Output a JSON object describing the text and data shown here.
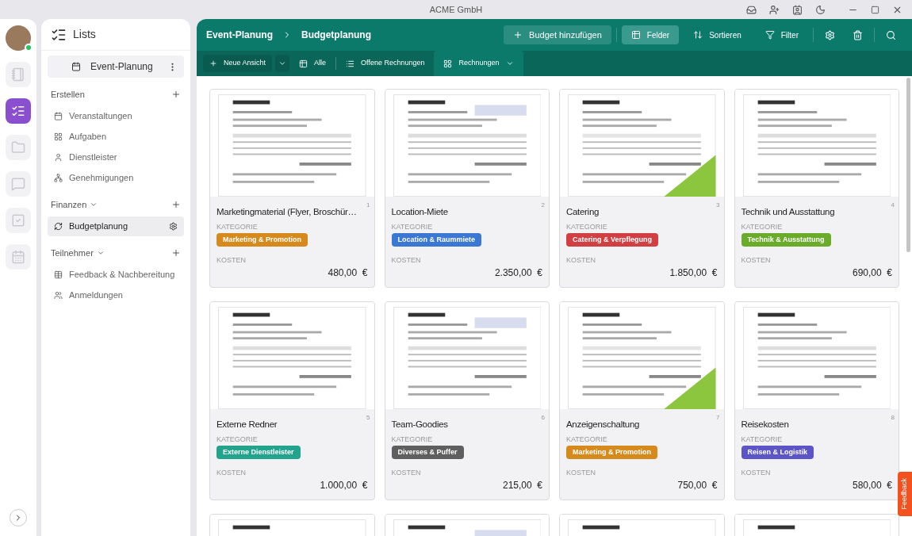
{
  "window": {
    "title": "ACME GmbH"
  },
  "rail": {
    "online": true,
    "items": [
      {
        "kind": "notebook",
        "selected": false
      },
      {
        "kind": "lists",
        "selected": true
      },
      {
        "kind": "folder",
        "selected": false
      },
      {
        "kind": "chat",
        "selected": false
      },
      {
        "kind": "tasks",
        "selected": false
      },
      {
        "kind": "calendar",
        "selected": false
      }
    ]
  },
  "sidebar": {
    "title": "Lists",
    "workspace": "Event-Planung",
    "sections": [
      {
        "title": "Erstellen",
        "collapsible": false,
        "items": [
          {
            "label": "Veranstaltungen",
            "kind": "calendar",
            "selected": false
          },
          {
            "label": "Aufgaben",
            "kind": "grid",
            "selected": false
          },
          {
            "label": "Dienstleister",
            "kind": "person",
            "selected": false
          },
          {
            "label": "Genehmigungen",
            "kind": "org",
            "selected": false
          }
        ]
      },
      {
        "title": "Finanzen",
        "collapsible": true,
        "items": [
          {
            "label": "Budgetplanung",
            "kind": "cycle",
            "selected": true
          }
        ]
      },
      {
        "title": "Teilnehmer",
        "collapsible": true,
        "items": [
          {
            "label": "Feedback & Nachbereitung",
            "kind": "table",
            "selected": false
          },
          {
            "label": "Anmeldungen",
            "kind": "people",
            "selected": false
          }
        ]
      }
    ]
  },
  "breadcrumb": [
    "Event-Planung",
    "Budgetplanung"
  ],
  "toolbar": [
    {
      "kind": "add",
      "label": "Budget hinzufügen",
      "selected": false
    },
    {
      "kind": "fields",
      "label": "Felder",
      "selected": true
    },
    {
      "kind": "sort",
      "label": "Sortieren",
      "selected": false
    },
    {
      "kind": "filter",
      "label": "Filter",
      "selected": false
    }
  ],
  "views": {
    "new_view": "Neue Ansicht",
    "items": [
      {
        "kind": "table",
        "label": "Alle",
        "selected": false
      },
      {
        "kind": "list",
        "label": "Offene Rechnungen",
        "selected": false
      },
      {
        "kind": "cards",
        "label": "Rechnungen",
        "selected": true
      }
    ]
  },
  "cards": [
    {
      "kind": "invoice",
      "title": "Marketingmaterial (Flyer, Broschür…",
      "number": "1",
      "category_label": "KATEGORIE",
      "category": "Marketing & Promotion",
      "color": "#d68a1c",
      "cost_label": "KOSTEN",
      "amount": "480,00  €"
    },
    {
      "kind": "invoice",
      "title": "Location-Miete",
      "number": "2",
      "category_label": "KATEGORIE",
      "category": "Location & Raummiete",
      "color": "#3a78d4",
      "cost_label": "KOSTEN",
      "amount": "2.350,00  €"
    },
    {
      "kind": "invoice",
      "title": "Catering",
      "number": "3",
      "category_label": "KATEGORIE",
      "category": "Catering & Verpflegung",
      "color": "#d13f42",
      "cost_label": "KOSTEN",
      "amount": "1.850,00  €"
    },
    {
      "kind": "invoice",
      "title": "Technik und Ausstattung",
      "number": "4",
      "category_label": "KATEGORIE",
      "category": "Technik & Ausstattung",
      "color": "#6aab2a",
      "cost_label": "KOSTEN",
      "amount": "690,00  €"
    },
    {
      "kind": "invoice",
      "title": "Externe Redner",
      "number": "5",
      "category_label": "KATEGORIE",
      "category": "Externe Dienstleister",
      "color": "#22a38b",
      "cost_label": "KOSTEN",
      "amount": "1.000,00  €"
    },
    {
      "kind": "invoice",
      "title": "Team-Goodies",
      "number": "6",
      "category_label": "KATEGORIE",
      "category": "Diverses & Puffer",
      "color": "#5f5f5f",
      "cost_label": "KOSTEN",
      "amount": "215,00  €"
    },
    {
      "kind": "invoice",
      "title": "Anzeigenschaltung",
      "number": "7",
      "category_label": "KATEGORIE",
      "category": "Marketing & Promotion",
      "color": "#d68a1c",
      "cost_label": "KOSTEN",
      "amount": "750,00  €"
    },
    {
      "kind": "invoice",
      "title": "Reisekosten",
      "number": "8",
      "category_label": "KATEGORIE",
      "category": "Reisen & Logistik",
      "color": "#5b55c8",
      "cost_label": "KOSTEN",
      "amount": "580,00  €"
    },
    {
      "kind": "picture"
    },
    {
      "kind": "picture"
    },
    {
      "kind": "picture"
    },
    {
      "kind": "picture"
    }
  ],
  "feedback_tab": "Feedback"
}
